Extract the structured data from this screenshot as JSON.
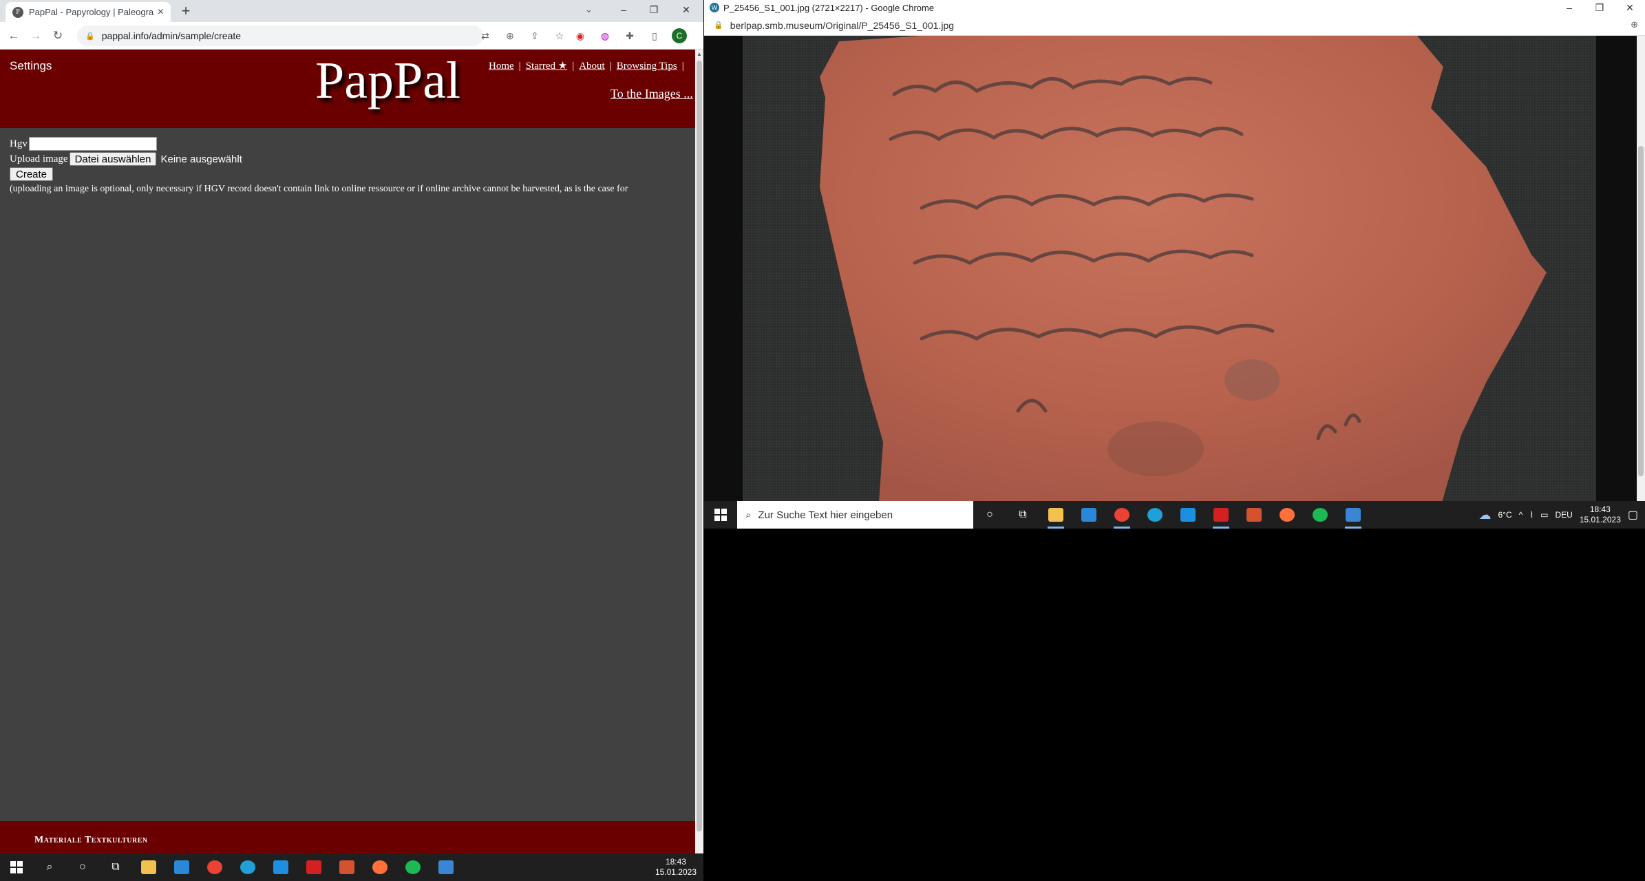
{
  "left_window": {
    "tab_title": "PapPal - Papyrology | Paleograph",
    "url": "pappal.info/admin/sample/create",
    "avatar_letter": "C",
    "site": {
      "settings_label": "Settings",
      "logo": "PapPal",
      "nav": [
        "Home",
        "Starred ★",
        "About",
        "Browsing Tips"
      ],
      "to_images": "To the Images ..."
    },
    "form": {
      "hgv_label": "Hgv",
      "hgv_value": "",
      "upload_label": "Upload image",
      "choose_file_button": "Datei auswählen",
      "no_file_text": "Keine ausgewählt",
      "create_button": "Create",
      "note": "(uploading an image is optional, only necessary if HGV record doesn't contain link to online ressource or if online archive cannot be harvested, as is the case for"
    },
    "footer_text": "Materiale Textkulturen"
  },
  "right_window": {
    "title": "P_25456_S1_001.jpg (2721×2217) - Google Chrome",
    "url": "berlpap.smb.museum/Original/P_25456_S1_001.jpg"
  },
  "taskbar": {
    "search_placeholder": "Zur Suche Text hier eingeben",
    "weather": "6°C",
    "language": "DEU",
    "time": "18:43",
    "date": "15.01.2023",
    "apps": [
      "file-explorer-icon",
      "store-icon",
      "chrome-icon",
      "edge-icon",
      "mail-icon",
      "acrobat-icon",
      "powerpoint-icon",
      "firefox-icon",
      "spotify-icon",
      "photos-icon"
    ],
    "app_colors": [
      "#f2c14e",
      "#2b88d8",
      "#ea4335",
      "#1fa0d8",
      "#1d8fe0",
      "#d42020",
      "#d35230",
      "#ff7139",
      "#1db954",
      "#3a86d4"
    ]
  }
}
